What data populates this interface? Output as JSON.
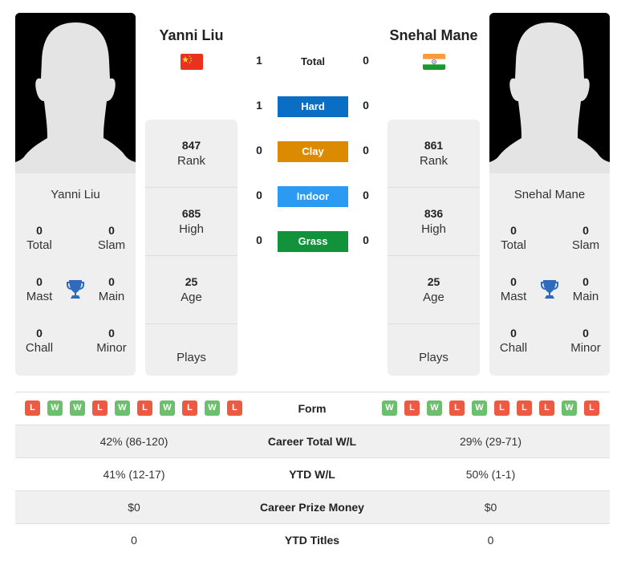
{
  "player1": {
    "name": "Yanni Liu",
    "card_name": "Yanni Liu",
    "flag": "china-flag",
    "rank": "847",
    "rank_label": "Rank",
    "high": "685",
    "high_label": "High",
    "age": "25",
    "age_label": "Age",
    "plays_label": "Plays",
    "titles": [
      {
        "value": "0",
        "label": "Total"
      },
      {
        "value": "0",
        "label": "Slam"
      },
      {
        "value": "0",
        "label": "Mast"
      },
      {
        "value": "0",
        "label": "Main"
      },
      {
        "value": "0",
        "label": "Chall"
      },
      {
        "value": "0",
        "label": "Minor"
      }
    ],
    "form": [
      "L",
      "W",
      "W",
      "L",
      "W",
      "L",
      "W",
      "L",
      "W",
      "L"
    ]
  },
  "player2": {
    "name": "Snehal Mane",
    "card_name": "Snehal Mane",
    "flag": "india-flag",
    "rank": "861",
    "rank_label": "Rank",
    "high": "836",
    "high_label": "High",
    "age": "25",
    "age_label": "Age",
    "plays_label": "Plays",
    "titles": [
      {
        "value": "0",
        "label": "Total"
      },
      {
        "value": "0",
        "label": "Slam"
      },
      {
        "value": "0",
        "label": "Mast"
      },
      {
        "value": "0",
        "label": "Main"
      },
      {
        "value": "0",
        "label": "Chall"
      },
      {
        "value": "0",
        "label": "Minor"
      }
    ],
    "form": [
      "W",
      "L",
      "W",
      "L",
      "W",
      "L",
      "L",
      "L",
      "W",
      "L"
    ]
  },
  "h2h": [
    {
      "label": "Total",
      "p1": "1",
      "p2": "0",
      "color": null
    },
    {
      "label": "Hard",
      "p1": "1",
      "p2": "0",
      "color": "#0a6ec4"
    },
    {
      "label": "Clay",
      "p1": "0",
      "p2": "0",
      "color": "#dc8a00"
    },
    {
      "label": "Indoor",
      "p1": "0",
      "p2": "0",
      "color": "#2a9af2"
    },
    {
      "label": "Grass",
      "p1": "0",
      "p2": "0",
      "color": "#12923a"
    }
  ],
  "form_label": "Form",
  "form_colors": {
    "W": "#6dbf6d",
    "L": "#ed5a42"
  },
  "comparison": [
    {
      "label": "Career Total W/L",
      "p1": "42% (86-120)",
      "p2": "29% (29-71)"
    },
    {
      "label": "YTD W/L",
      "p1": "41% (12-17)",
      "p2": "50% (1-1)"
    },
    {
      "label": "Career Prize Money",
      "p1": "$0",
      "p2": "$0"
    },
    {
      "label": "YTD Titles",
      "p1": "0",
      "p2": "0"
    }
  ],
  "trophy_color": "#2f6bbd"
}
